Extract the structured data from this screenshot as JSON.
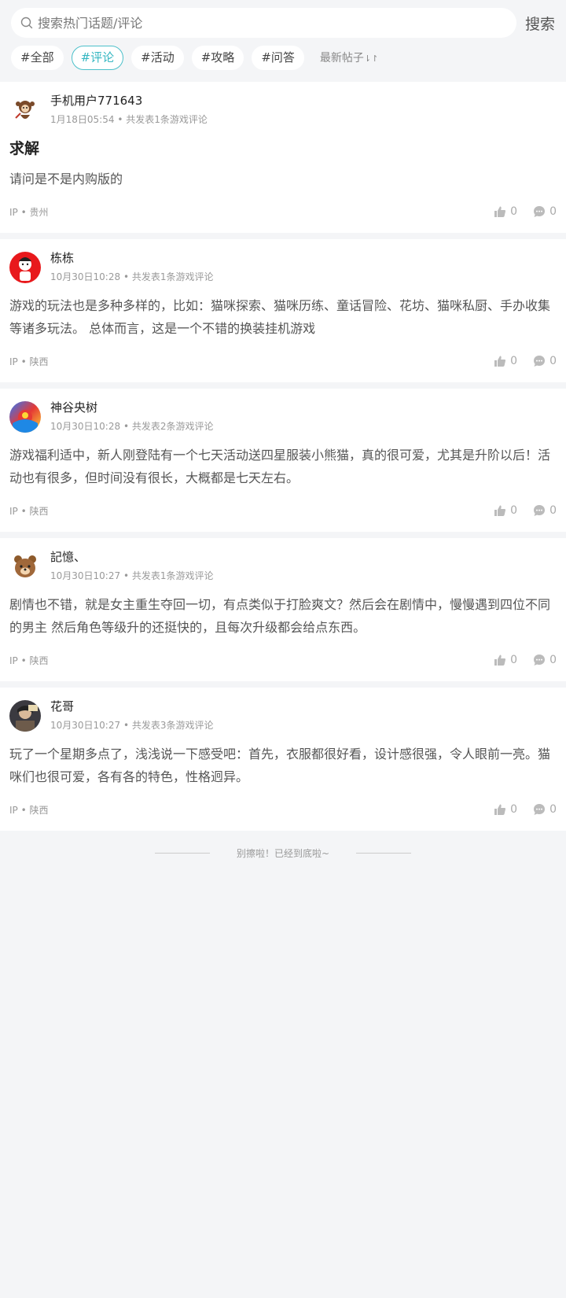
{
  "search": {
    "placeholder": "搜索热门话题/评论",
    "button": "搜索"
  },
  "tags": [
    "#全部",
    "#评论",
    "#活动",
    "#攻略",
    "#问答"
  ],
  "active_tag_index": 1,
  "sort": {
    "label": "最新帖子",
    "icon": "sort-arrows-icon"
  },
  "posts": [
    {
      "username": "手机用户771643",
      "time": "1月18日05:54",
      "summary": "共发表1条游戏评论",
      "title": "求解",
      "content": "请问是不是内购版的",
      "ip": "IP • 贵州",
      "likes": "0",
      "comments": "0",
      "avatar": "monkey-avatar"
    },
    {
      "username": "栋栋",
      "time": "10月30日10:28",
      "summary": "共发表1条游戏评论",
      "title": "",
      "content": "游戏的玩法也是多种多样的，比如：猫咪探索、猫咪历练、童话冒险、花坊、猫咪私厨、手办收集等诸多玩法。 总体而言，这是一个不错的换装挂机游戏",
      "ip": "IP • 陕西",
      "likes": "0",
      "comments": "0",
      "avatar": "red-character-avatar"
    },
    {
      "username": "神谷央树",
      "time": "10月30日10:28",
      "summary": "共发表2条游戏评论",
      "title": "",
      "content": "游戏福利适中，新人刚登陆有一个七天活动送四星服装小熊猫，真的很可爱，尤其是升阶以后！活动也有很多，但时间没有很长，大概都是七天左右。",
      "ip": "IP • 陕西",
      "likes": "0",
      "comments": "0",
      "avatar": "colorful-avatar"
    },
    {
      "username": "記憶、",
      "time": "10月30日10:27",
      "summary": "共发表1条游戏评论",
      "title": "",
      "content": "剧情也不错，就是女主重生夺回一切，有点类似于打脸爽文？然后会在剧情中，慢慢遇到四位不同的男主 然后角色等级升的还挺快的，且每次升级都会给点东西。",
      "ip": "IP • 陕西",
      "likes": "0",
      "comments": "0",
      "avatar": "bear-avatar"
    },
    {
      "username": "花哥",
      "time": "10月30日10:27",
      "summary": "共发表3条游戏评论",
      "title": "",
      "content": "玩了一个星期多点了，浅浅说一下感受吧：首先，衣服都很好看，设计感很强，令人眼前一亮。猫咪们也很可爱，各有各的特色，性格迥异。",
      "ip": "IP • 陕西",
      "likes": "0",
      "comments": "0",
      "avatar": "photo-avatar"
    }
  ],
  "end_note": "别擦啦！已经到底啦~",
  "colors": {
    "accent": "#36b7c2",
    "background": "#f4f5f7"
  }
}
